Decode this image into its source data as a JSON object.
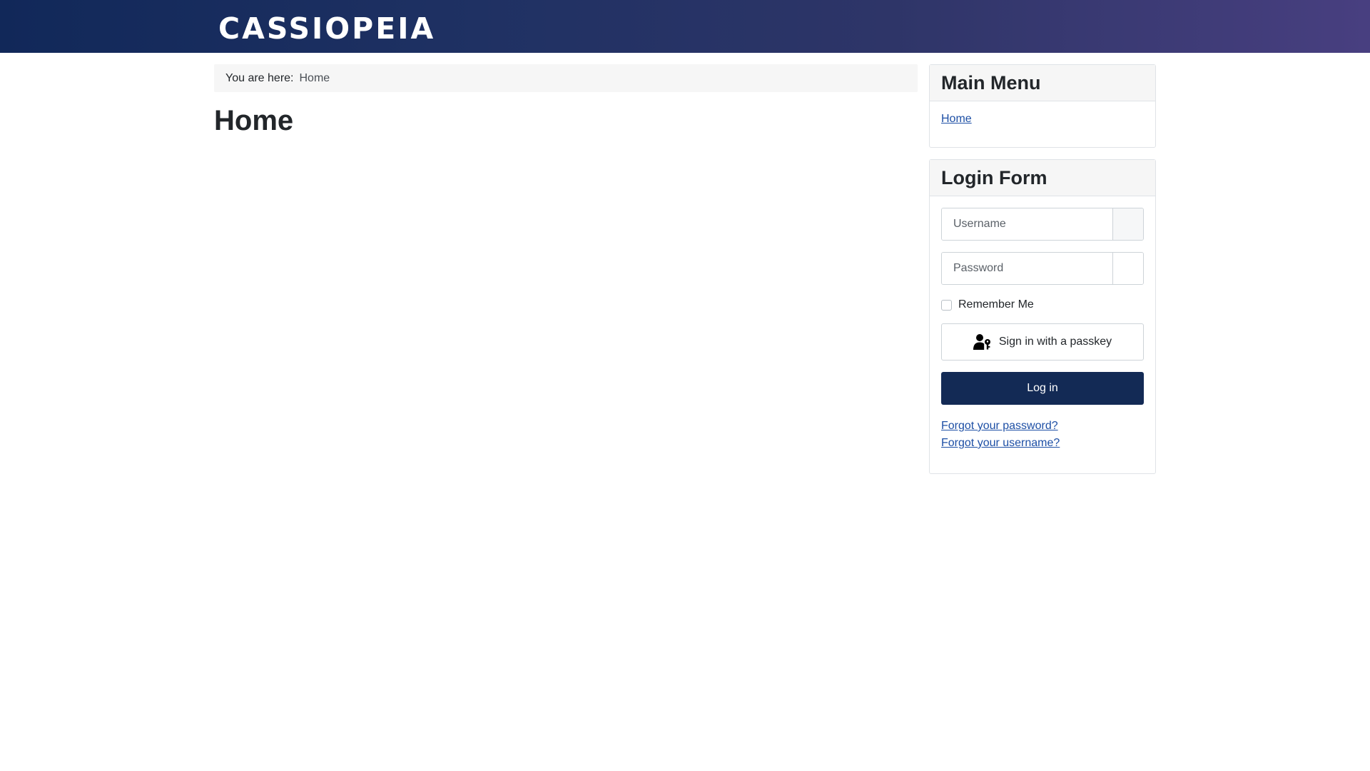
{
  "header": {
    "brand": "CASSIOPEIA"
  },
  "breadcrumb": {
    "label": "You are here:",
    "current": "Home"
  },
  "page": {
    "title": "Home"
  },
  "main_menu": {
    "title": "Main Menu",
    "items": [
      {
        "label": "Home"
      }
    ]
  },
  "login_form": {
    "title": "Login Form",
    "username_placeholder": "Username",
    "password_placeholder": "Password",
    "remember_label": "Remember Me",
    "passkey_label": "Sign in with a passkey",
    "login_label": "Log in",
    "forgot_password": "Forgot your password?",
    "forgot_username": "Forgot your username?"
  },
  "colors": {
    "header_start": "#112859",
    "header_end": "#483f80",
    "primary_button": "#132a55",
    "link": "#1d4fa5"
  },
  "icons": {
    "passkey": "user-key-icon"
  }
}
